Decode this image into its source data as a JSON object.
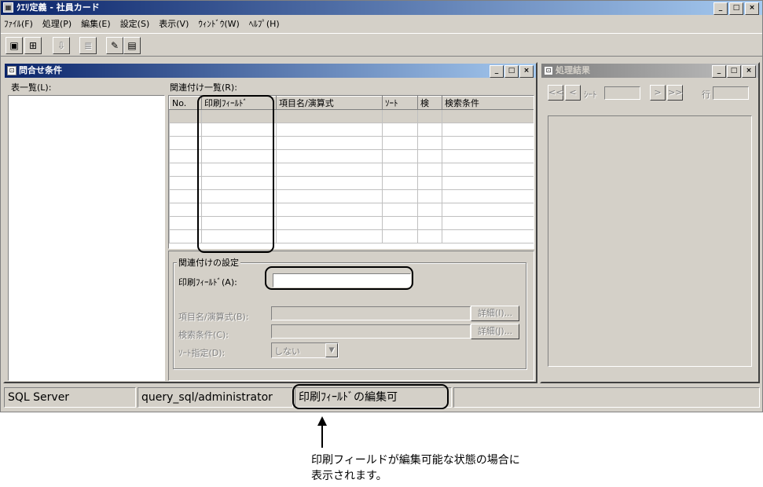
{
  "app": {
    "title": "ｸｴﾘ定義 - 社員カード"
  },
  "menu": [
    "ﾌｧｲﾙ(F)",
    "処理(P)",
    "編集(E)",
    "設定(S)",
    "表示(V)",
    "ｳｨﾝﾄﾞｳ(W)",
    "ﾍﾙﾌﾟ(H)"
  ],
  "toolbar": {
    "icons": [
      "save-icon",
      "import-icon",
      "export-icon",
      "list-icon",
      "edit-icon",
      "query-icon"
    ]
  },
  "query_window": {
    "title": "問合せ条件",
    "table_list_label": "表一覧(L):",
    "relation_list_label": "関連付け一覧(R):",
    "columns": [
      "No.",
      "印刷ﾌｨｰﾙﾄﾞ",
      "項目名/演算式",
      "ｿｰﾄ",
      "検",
      "検索条件"
    ]
  },
  "settings": {
    "group_title": "関連付けの設定",
    "print_field_label": "印刷ﾌｨｰﾙﾄﾞ(A):",
    "print_field_value": "",
    "item_label": "項目名/演算式(B):",
    "detail1": "詳細(I)...",
    "search_label": "検索条件(C):",
    "detail2": "詳細(J)...",
    "sort_label": "ｿｰﾄ指定(D):",
    "sort_value": "しない"
  },
  "result_window": {
    "title": "処理結果",
    "first_btn": "<<",
    "prev_btn": "<",
    "sheet_label": "ｼｰﾄ",
    "next_btn": ">",
    "last_btn": ">>",
    "row_label": "行"
  },
  "status": {
    "server": "SQL Server",
    "connection": "query_sql/administrator",
    "message": "印刷ﾌｨｰﾙﾄﾞの編集可"
  },
  "annotation": {
    "line1": "印刷フィールドが編集可能な状態の場合に",
    "line2": "表示されます。"
  }
}
